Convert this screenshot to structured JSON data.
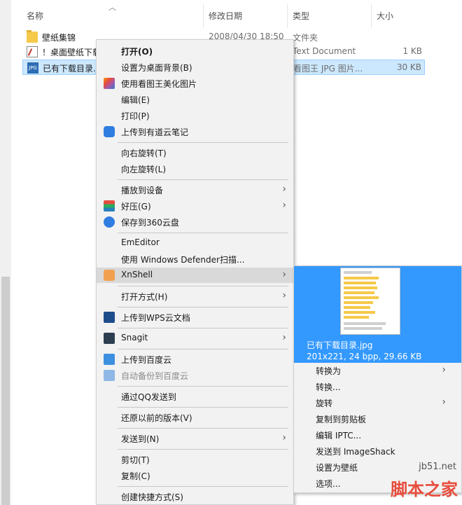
{
  "columns": {
    "name": "名称",
    "date": "修改日期",
    "type": "类型",
    "size": "大小"
  },
  "files": [
    {
      "name": "壁纸集锦",
      "date": "2008/04/30 18:50",
      "type": "文件夹",
      "size": ""
    },
    {
      "name": "！桌面壁纸下载",
      "date": "",
      "type": "Text Document",
      "size": "1 KB"
    },
    {
      "name": "已有下载目录.jpg",
      "date": "",
      "type": "看图王 JPG 图片...",
      "size": "30 KB"
    }
  ],
  "file_icons": [
    "folder-icon",
    "text-document-icon",
    "jpg-file-icon"
  ],
  "menu": {
    "open": "打开(O)",
    "set_wallpaper": "设置为桌面背景(B)",
    "beautify": "使用看图王美化图片",
    "edit": "编辑(E)",
    "print": "打印(P)",
    "youdao": "上传到有道云笔记",
    "rotate_right": "向右旋转(T)",
    "rotate_left": "向左旋转(L)",
    "cast": "播放到设备",
    "haozip": "好压(G)",
    "save360": "保存到360云盘",
    "emeditor": "EmEditor",
    "defender": "使用 Windows Defender扫描...",
    "xnshell": "XnShell",
    "open_with": "打开方式(H)",
    "wps": "上传到WPS云文档",
    "snagit": "Snagit",
    "baidu_upload": "上传到百度云",
    "baidu_backup": "自动备份到百度云",
    "qq_send": "通过QQ发送到",
    "restore": "还原以前的版本(V)",
    "send_to": "发送到(N)",
    "cut": "剪切(T)",
    "copy": "复制(C)",
    "shortcut": "创建快捷方式(S)"
  },
  "submenu": {
    "preview_name": "已有下载目录.jpg",
    "preview_info": "201x221, 24 bpp, 29.66 KB",
    "convert_to": "转换为",
    "convert": "转换...",
    "rotate": "旋转",
    "copy_clipboard": "复制到剪贴板",
    "edit_iptc": "编辑 IPTC...",
    "send_imageshack": "发送到 ImageShack",
    "set_wallpaper": "设置为壁纸",
    "options": "选项..."
  },
  "watermark": {
    "url": "jb51.net",
    "text": "脚本之家"
  },
  "colors": {
    "highlight": "#cce8ff",
    "preview_bg": "#3399ff",
    "watermark": "#e74c3c"
  }
}
